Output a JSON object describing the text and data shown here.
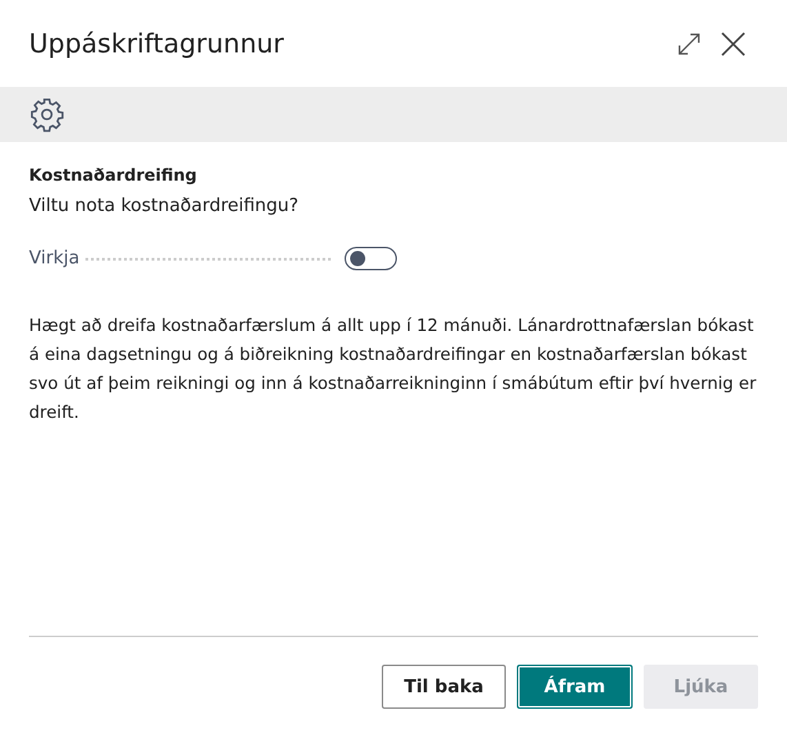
{
  "window": {
    "title": "Uppáskriftagrunnur"
  },
  "section": {
    "heading": "Kostnaðardreifing",
    "question": "Viltu nota kostnaðardreifingu?"
  },
  "toggle": {
    "label": "Virkja",
    "on": false
  },
  "description": "Hægt að dreifa kostnaðarfærslum á allt upp í 12 mánuði. Lánardrottnafærslan bókast á eina dagsetningu og á biðreikning kostnaðardreifingar en kostnaðarfærslan bókast svo út af þeim reikningi og inn á kostnaðarreikninginn í smábútum eftir því hvernig er dreift.",
  "buttons": [
    {
      "label": "Til baka",
      "kind": "secondary",
      "disabled": false
    },
    {
      "label": "Áfram",
      "kind": "primary",
      "disabled": false
    },
    {
      "label": "Ljúka",
      "kind": "secondary",
      "disabled": true
    }
  ]
}
